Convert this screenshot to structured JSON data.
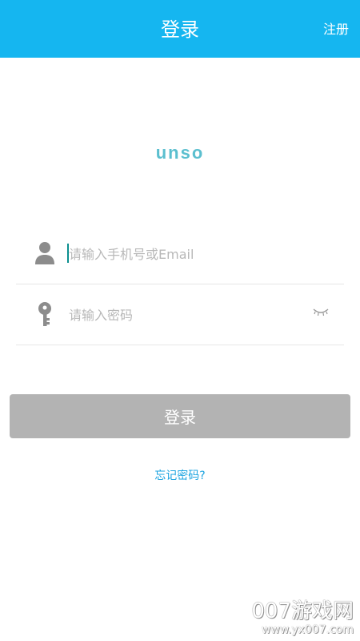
{
  "header": {
    "title": "登录",
    "register_label": "注册"
  },
  "logo": {
    "text": "unso"
  },
  "phone_field": {
    "placeholder": "请输入手机号或Email",
    "value": ""
  },
  "password_field": {
    "placeholder": "请输入密码",
    "value": ""
  },
  "login_button": {
    "label": "登录"
  },
  "forgot_link": {
    "label": "忘记密码?"
  },
  "watermark": {
    "title": "007游戏网",
    "url": "www.yx007.com"
  },
  "icons": {
    "user": "user-icon",
    "key": "key-icon",
    "eye": "eye-closed-icon"
  },
  "colors": {
    "header_bg": "#15b6f0",
    "logo": "#5bbfcf",
    "button_disabled": "#b3b3b3",
    "link": "#1aa3e0"
  }
}
